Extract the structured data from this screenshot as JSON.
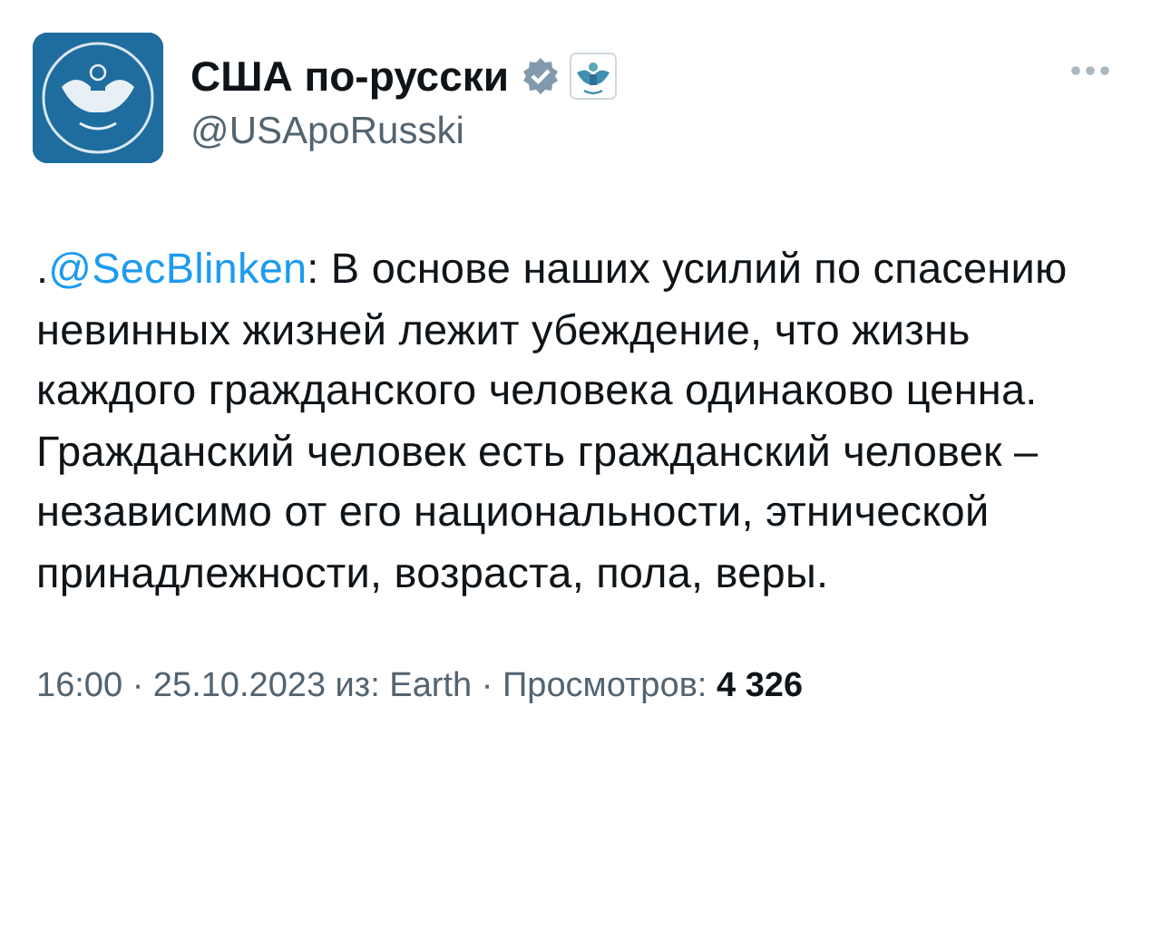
{
  "author": {
    "name": "США по-русски",
    "handle": "@USApoRusski",
    "verified": true
  },
  "tweet": {
    "prefix": ".",
    "mention": "@SecBlinken",
    "text": ": В основе наших усилий по спасению невинных жизней лежит убеждение, что жизнь каждого гражданского человека одинаково ценна. Гражданский человек есть гражданский человек – независимо от его национальности, этнической принадлежности, возраста, пола, веры."
  },
  "meta": "16:00 · 25.10.2023 из: Earth · Просмотров: **4 326**"
}
